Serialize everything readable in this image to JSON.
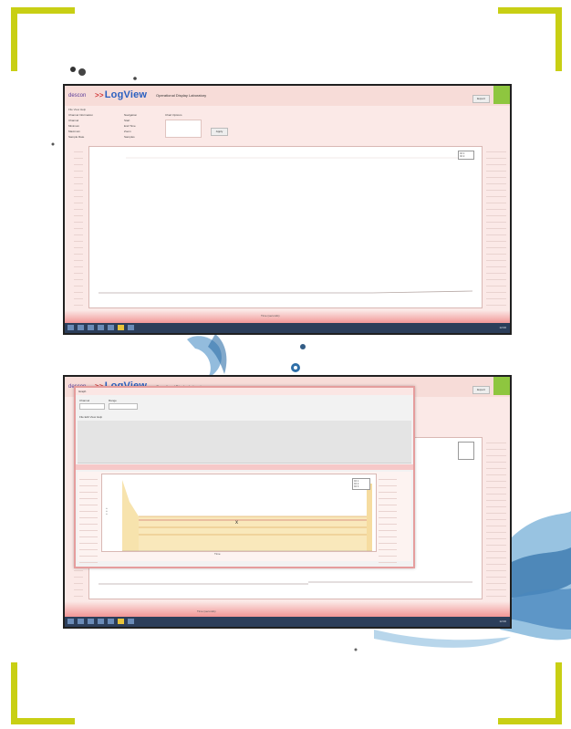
{
  "corners": {
    "color": "#c8cf14"
  },
  "screenshot_top": {
    "brand_prefix": "descon",
    "brand_name": "LogView",
    "app_title": "Operational Display Laboratory",
    "menu_label": "File  View  Help",
    "group1_title": "Channel Information",
    "group1_rows": [
      "Channel",
      "Minimum",
      "Maximum",
      "Sample Rate"
    ],
    "group2_title": "Navigation",
    "group2_rows": [
      "Start",
      "End Time",
      "Zoom",
      "Samples"
    ],
    "group3_title": "Chart Options",
    "apply_label": "Apply",
    "top_button_label": "Export",
    "legend_items": [
      "Ch 1",
      "Ch 2"
    ],
    "x_axis_label": "Time (seconds)",
    "taskbar_clock": "12:00"
  },
  "screenshot_bottom": {
    "brand_prefix": "descon",
    "brand_name": "LogView",
    "app_title": "Operational Display Laboratory",
    "top_button_label": "Export",
    "dialog_title": "Graph",
    "dialog_field1_label": "Channel",
    "dialog_field2_label": "Range",
    "dialog_menu_label": "File  Edit  View  Help",
    "dialog_legend_items": [
      "Ch 1",
      "Ch 2",
      "Ch 3"
    ],
    "dialog_x_axis_label": "Time",
    "x_axis_label": "Time (seconds)",
    "taskbar_clock": "12:00"
  }
}
